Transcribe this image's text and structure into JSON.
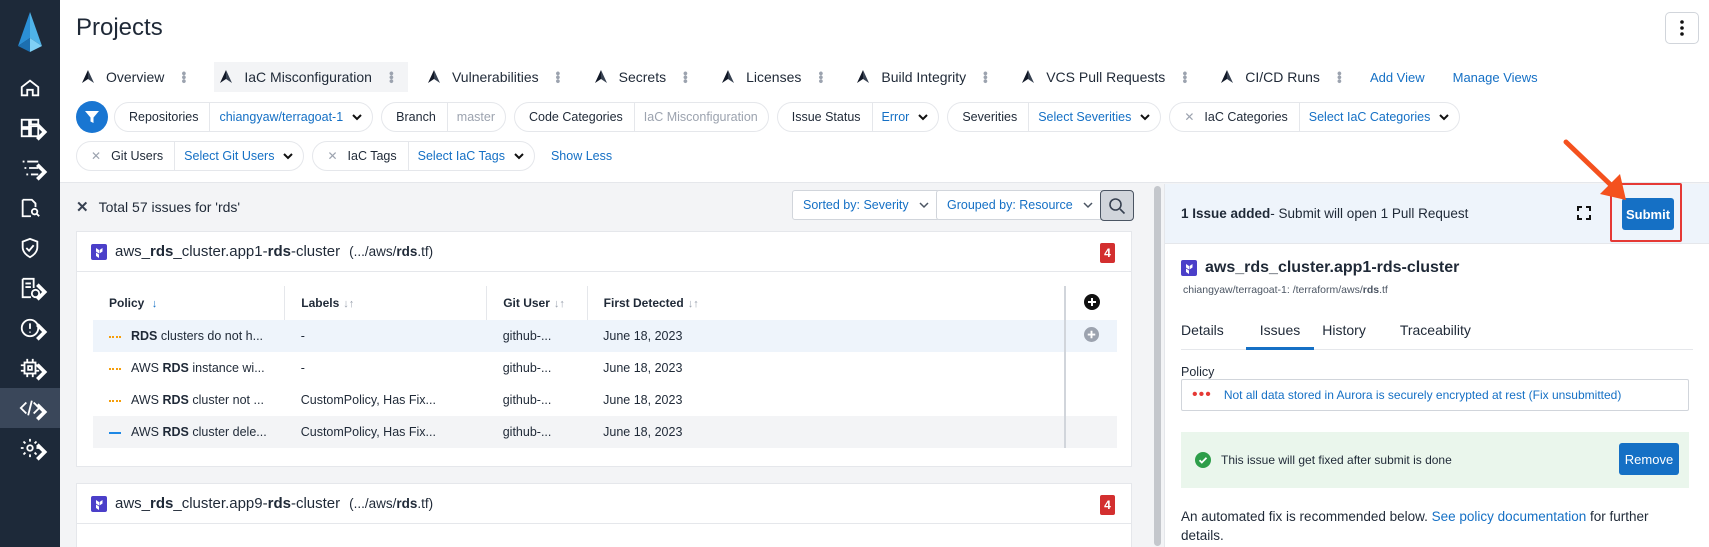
{
  "colors": {
    "accent": "#1570c5",
    "nav_bg": "#1d2939",
    "danger": "#d32f2f",
    "success_bg": "#eaf6ec"
  },
  "header": {
    "title": "Projects",
    "tabs": [
      {
        "label": "Overview"
      },
      {
        "label": "IaC Misconfiguration"
      },
      {
        "label": "Vulnerabilities"
      },
      {
        "label": "Secrets"
      },
      {
        "label": "Licenses"
      },
      {
        "label": "Build Integrity"
      },
      {
        "label": "VCS Pull Requests"
      },
      {
        "label": "CI/CD Runs"
      }
    ],
    "add_view": "Add View",
    "manage_views": "Manage Views"
  },
  "filters": {
    "repositories": {
      "label": "Repositories",
      "value": "chiangyaw/terragoat-1"
    },
    "branch": {
      "label": "Branch",
      "value": "master"
    },
    "code_categories": {
      "label": "Code Categories",
      "value": "IaC Misconfiguration"
    },
    "issue_status": {
      "label": "Issue Status",
      "value": "Error"
    },
    "severities": {
      "label": "Severities",
      "value": "Select Severities"
    },
    "iac_categories": {
      "label": "IaC Categories",
      "value": "Select IaC Categories"
    },
    "git_users": {
      "label": "Git Users",
      "value": "Select Git Users"
    },
    "iac_tags": {
      "label": "IaC Tags",
      "value": "Select IaC Tags"
    },
    "show_less": "Show Less"
  },
  "results": {
    "summary": "Total 57 issues for 'rds'",
    "sorted_by": "Sorted by: Severity",
    "grouped_by": "Grouped by: Resource",
    "columns": [
      "Policy",
      "Labels",
      "Git User",
      "First Detected"
    ],
    "cards": [
      {
        "pre": "aws_",
        "b1": "rds",
        "mid": "_cluster.app1-",
        "b2": "rds",
        "post": "-cluster",
        "path_pre": "(.../aws/",
        "path_b": "rds",
        "path_post": ".tf)",
        "count": "4"
      },
      {
        "pre": "aws_",
        "b1": "rds",
        "mid": "_cluster.app9-",
        "b2": "rds",
        "post": "-cluster",
        "path_pre": "(.../aws/",
        "path_b": "rds",
        "path_post": ".tf)",
        "count": "4"
      }
    ],
    "rows": [
      {
        "policy_pre": "",
        "policy_b": "RDS",
        "policy_post": " clusters do not h...",
        "labels": "-",
        "git_user": "github-...",
        "first_detected": "June 18, 2023",
        "sev_color": "#f59e0b"
      },
      {
        "policy_pre": "AWS ",
        "policy_b": "RDS",
        "policy_post": " instance wi...",
        "labels": "-",
        "git_user": "github-...",
        "first_detected": "June 18, 2023",
        "sev_color": "#f59e0b"
      },
      {
        "policy_pre": "AWS ",
        "policy_b": "RDS",
        "policy_post": " cluster not ...",
        "labels": "CustomPolicy, Has Fix...",
        "git_user": "github-...",
        "first_detected": "June 18, 2023",
        "sev_color": "#f59e0b"
      },
      {
        "policy_pre": "AWS ",
        "policy_b": "RDS",
        "policy_post": " cluster dele...",
        "labels": "CustomPolicy, Has Fix...",
        "git_user": "github-...",
        "first_detected": "June 18, 2023",
        "sev_color": "#1e88e5"
      }
    ]
  },
  "detail": {
    "added_bold": "1 Issue added",
    "added_rest": " - Submit will open 1 Pull Request",
    "submit": "Submit",
    "resource": "aws_rds_cluster.app1-rds-cluster",
    "path_pre": "chiangyaw/terragoat-1: /terraform/aws/",
    "path_b": "rds",
    "path_post": ".tf",
    "tabs": [
      "Details",
      "Issues",
      "History",
      "Traceability"
    ],
    "policy_label": "Policy",
    "policy_value": "Not all data stored in Aurora is securely encrypted at rest (Fix unsubmitted)",
    "success_msg": "This issue will get fixed after submit is done",
    "remove": "Remove",
    "autofix_pre": "An automated fix is recommended below. ",
    "autofix_link": "See policy documentation",
    "autofix_post": " for further details."
  }
}
